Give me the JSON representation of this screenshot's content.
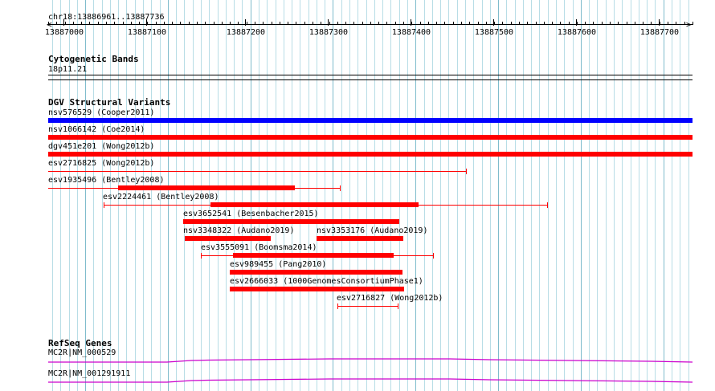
{
  "ruler": {
    "location": "chr18:13886961..13887736",
    "ticks": [
      "13887000",
      "13887100",
      "13887200",
      "13887300",
      "13887400",
      "13887500",
      "13887600",
      "13887700"
    ]
  },
  "cytogenetic_bands": {
    "title": "Cytogenetic Bands",
    "band": "18p11.21"
  },
  "dgv": {
    "title": "DGV Structural Variants",
    "variants": [
      {
        "label": "nsv576529 (Cooper2011)",
        "color": "#0000ff"
      },
      {
        "label": "nsv1066142 (Coe2014)",
        "color": "#ff0000"
      },
      {
        "label": "dgv451e201 (Wong2012b)",
        "color": "#ff0000"
      },
      {
        "label": "esv2716825 (Wong2012b)",
        "color": "#ff0000"
      },
      {
        "label": "esv1935496 (Bentley2008)",
        "color": "#ff0000"
      },
      {
        "label": "esv2224461 (Bentley2008)",
        "color": "#ff0000"
      },
      {
        "label": "esv3652541 (Besenbacher2015)",
        "color": "#ff0000"
      },
      {
        "label": "nsv3348322 (Audano2019)",
        "color": "#ff0000"
      },
      {
        "label": "nsv3353176 (Audano2019)",
        "color": "#ff0000"
      },
      {
        "label": "esv3555091 (Boomsma2014)",
        "color": "#ff0000"
      },
      {
        "label": "esv989455 (Pang2010)",
        "color": "#ff0000"
      },
      {
        "label": "esv2666033 (1000GenomesConsortiumPhase1)",
        "color": "#ff0000"
      },
      {
        "label": "esv2716827 (Wong2012b)",
        "color": "#ff0000"
      }
    ]
  },
  "refseq": {
    "title": "RefSeq Genes",
    "color": "#cc00cc",
    "genes": [
      {
        "label": "MC2R|NM_000529"
      },
      {
        "label": "MC2R|NM_001291911"
      }
    ]
  }
}
